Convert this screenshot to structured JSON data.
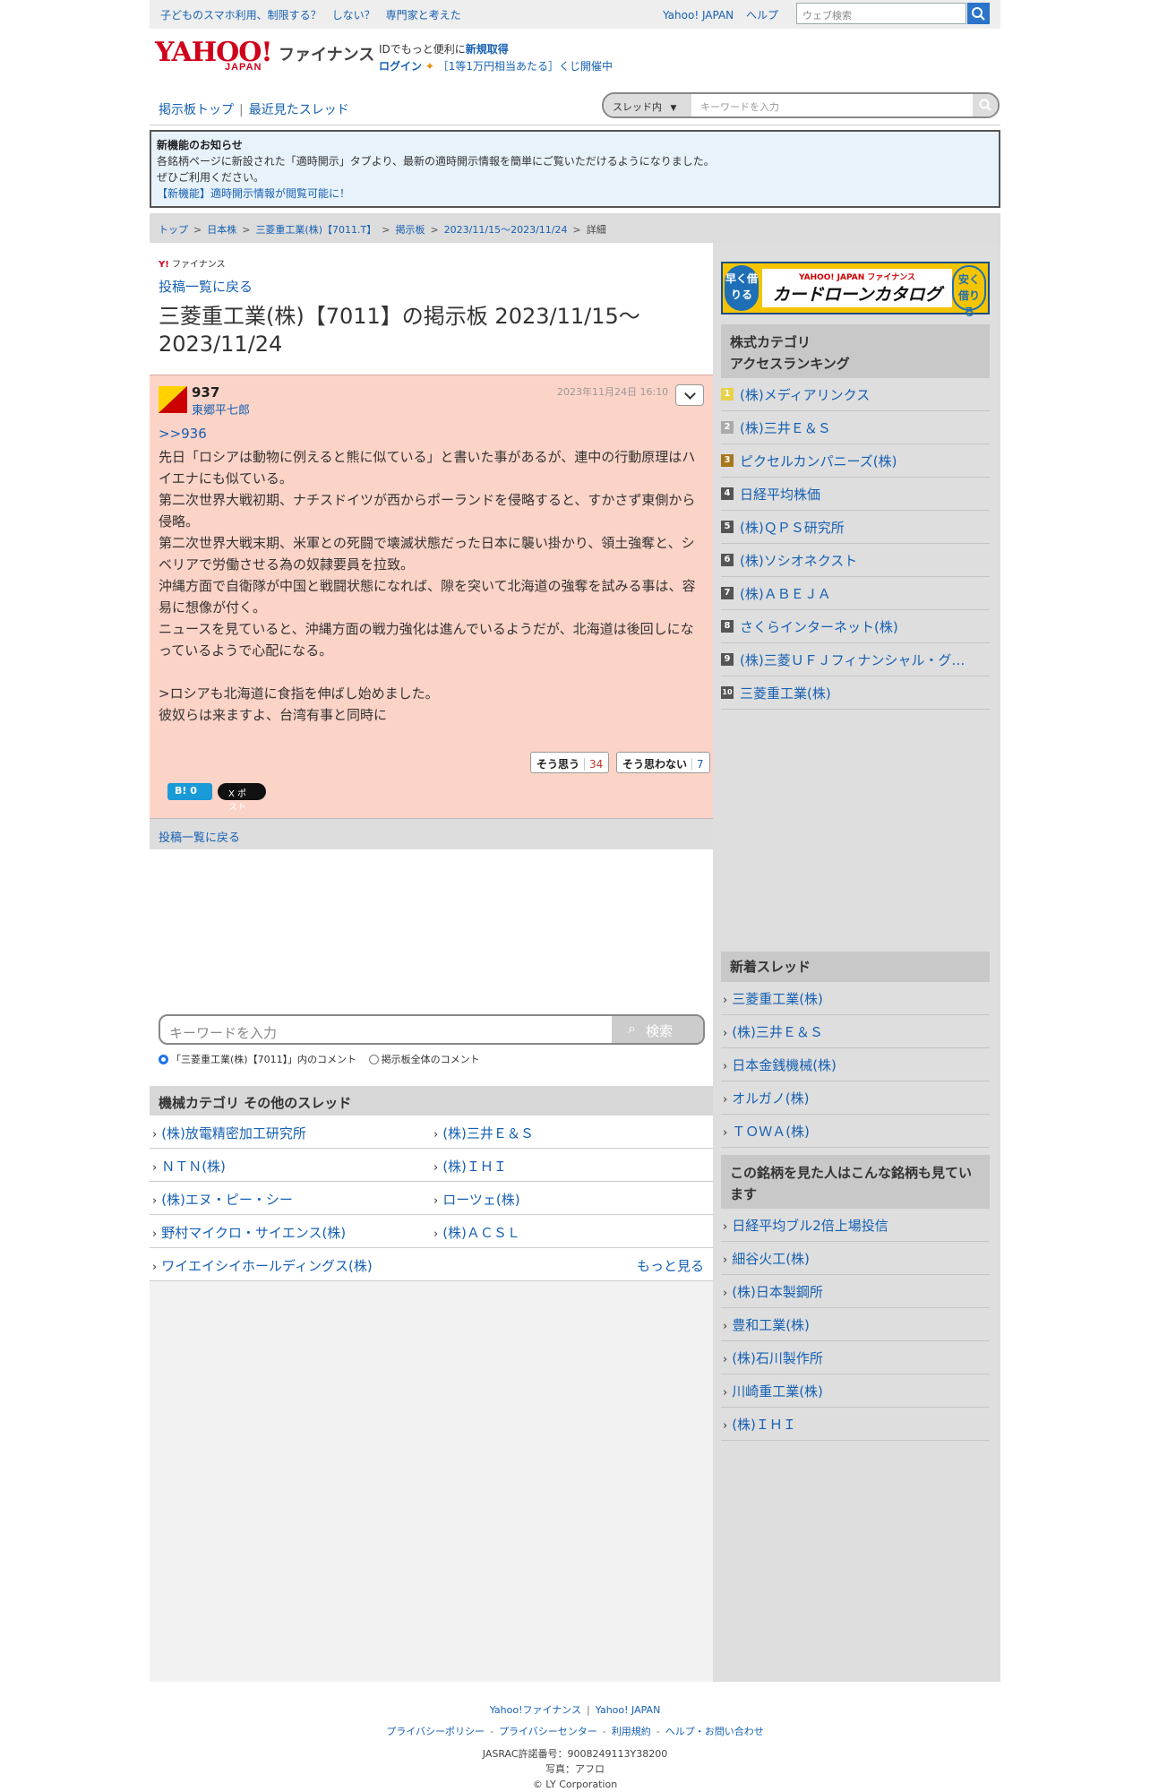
{
  "topbar": {
    "promo": "子どものスマホ利用、制限する？　しない？　専門家と考えた",
    "links": [
      "Yahoo! JAPAN",
      "ヘルプ"
    ],
    "search_placeholder": "ウェブ検索"
  },
  "header": {
    "logo_text": "YAHOO!",
    "logo_sub": "JAPAN",
    "service": "ファイナンス",
    "id_promo_prefix": "IDでもっと便利に",
    "signup": "新規取得",
    "login": "ログイン",
    "lottery": "［1等1万円相当あたる］くじ開催中"
  },
  "board_nav": {
    "top": "掲示板トップ",
    "recent": "最近見たスレッド",
    "scope": "スレッド内",
    "search_placeholder": "キーワードを入力"
  },
  "notice": {
    "title": "新機能のお知らせ",
    "line1": "各銘柄ページに新設された「適時開示」タブより、最新の適時開示情報を簡単にご覧いただけるようになりました。",
    "line2": "ぜひご利用ください。",
    "link": "【新機能】適時開示情報が閲覧可能に！"
  },
  "breadcrumb": [
    "トップ",
    "日本株",
    "三菱重工業(株)【7011.T】",
    "掲示板",
    "2023/11/15〜2023/11/24",
    "詳細"
  ],
  "main": {
    "small_logo": "ファイナンス",
    "back": "投稿一覧に戻る",
    "title": "三菱重工業(株)【7011】の掲示板 2023/11/15〜2023/11/24"
  },
  "post": {
    "number": "937",
    "author": "東郷平七郎",
    "date": "2023年11月24日 16:10",
    "reply_to": ">>936",
    "body": "先日「ロシアは動物に例えると熊に似ている」と書いた事があるが、連中の行動原理はハイエナにも似ている。\n第二次世界大戦初期、ナチスドイツが西からポーランドを侵略すると、すかさず東側から侵略。\n第二次世界大戦末期、米軍との死闘で壊滅状態だった日本に襲い掛かり、領土強奪と、シベリアで労働させる為の奴隷要員を拉致。\n沖縄方面で自衛隊が中国と戦闘状態になれば、隙を突いて北海道の強奪を試みる事は、容易に想像が付く。\nニュースを見ていると、沖縄方面の戦力強化は進んでいるようだが、北海道は後回しになっているようで心配になる。\n\n>ロシアも北海道に食指を伸ばし始めました。\n彼奴らは来ますよ、台湾有事と同時に",
    "agree_label": "そう思う",
    "agree_count": "34",
    "disagree_label": "そう思わない",
    "disagree_count": "7",
    "hatena": "B! 0",
    "x_post": "X ポスト"
  },
  "back_bottom": "投稿一覧に戻る",
  "keyword_search": {
    "placeholder": "キーワードを入力",
    "button": "検索",
    "option1": "「三菱重工業(株)【7011】」内のコメント",
    "option2": "掲示板全体のコメント"
  },
  "category": {
    "heading": "機械カテゴリ その他のスレッド",
    "items": [
      "(株)放電精密加工研究所",
      "(株)三井Ｅ＆Ｓ",
      "ＮＴＮ(株)",
      "(株)ＩＨＩ",
      "(株)エヌ・ピー・シー",
      "ローツェ(株)",
      "野村マイクロ・サイエンス(株)",
      "(株)ＡＣＳＬ",
      "ワイエイシイホールディングス(株)"
    ],
    "more": "もっと見る"
  },
  "sidebar": {
    "banner": {
      "left": "早く借りる",
      "brand": "YAHOO! JAPAN ファイナンス",
      "title": "カードローンカタログ",
      "right": "安く借りる"
    },
    "ranking_heading": "株式カテゴリ\nアクセスランキング",
    "ranking": [
      "(株)メディアリンクス",
      "(株)三井Ｅ＆Ｓ",
      "ピクセルカンパニーズ(株)",
      "日経平均株価",
      "(株)ＱＰＳ研究所",
      "(株)ソシオネクスト",
      "(株)ＡＢＥＪＡ",
      "さくらインターネット(株)",
      "(株)三菱ＵＦＪフィナンシャル・グ…",
      "三菱重工業(株)"
    ],
    "new_heading": "新着スレッド",
    "new_threads": [
      "三菱重工業(株)",
      "(株)三井Ｅ＆Ｓ",
      "日本金銭機械(株)",
      "オルガノ(株)",
      "ＴＯＷＡ(株)"
    ],
    "also_heading": "この銘柄を見た人はこんな銘柄も見ています",
    "also": [
      "日経平均ブル2倍上場投信",
      "細谷火工(株)",
      "(株)日本製鋼所",
      "豊和工業(株)",
      "(株)石川製作所",
      "川崎重工業(株)",
      "(株)ＩＨＩ"
    ]
  },
  "footer": {
    "links1": [
      "Yahoo!ファイナンス",
      "Yahoo! JAPAN"
    ],
    "links2": [
      "プライバシーポリシー",
      "プライバシーセンター",
      "利用規約",
      "ヘルプ・お問い合わせ"
    ],
    "jasrac": "JASRAC許諾番号：9008249113Y38200",
    "photo": "写真：アフロ",
    "copyright": "© LY Corporation"
  }
}
